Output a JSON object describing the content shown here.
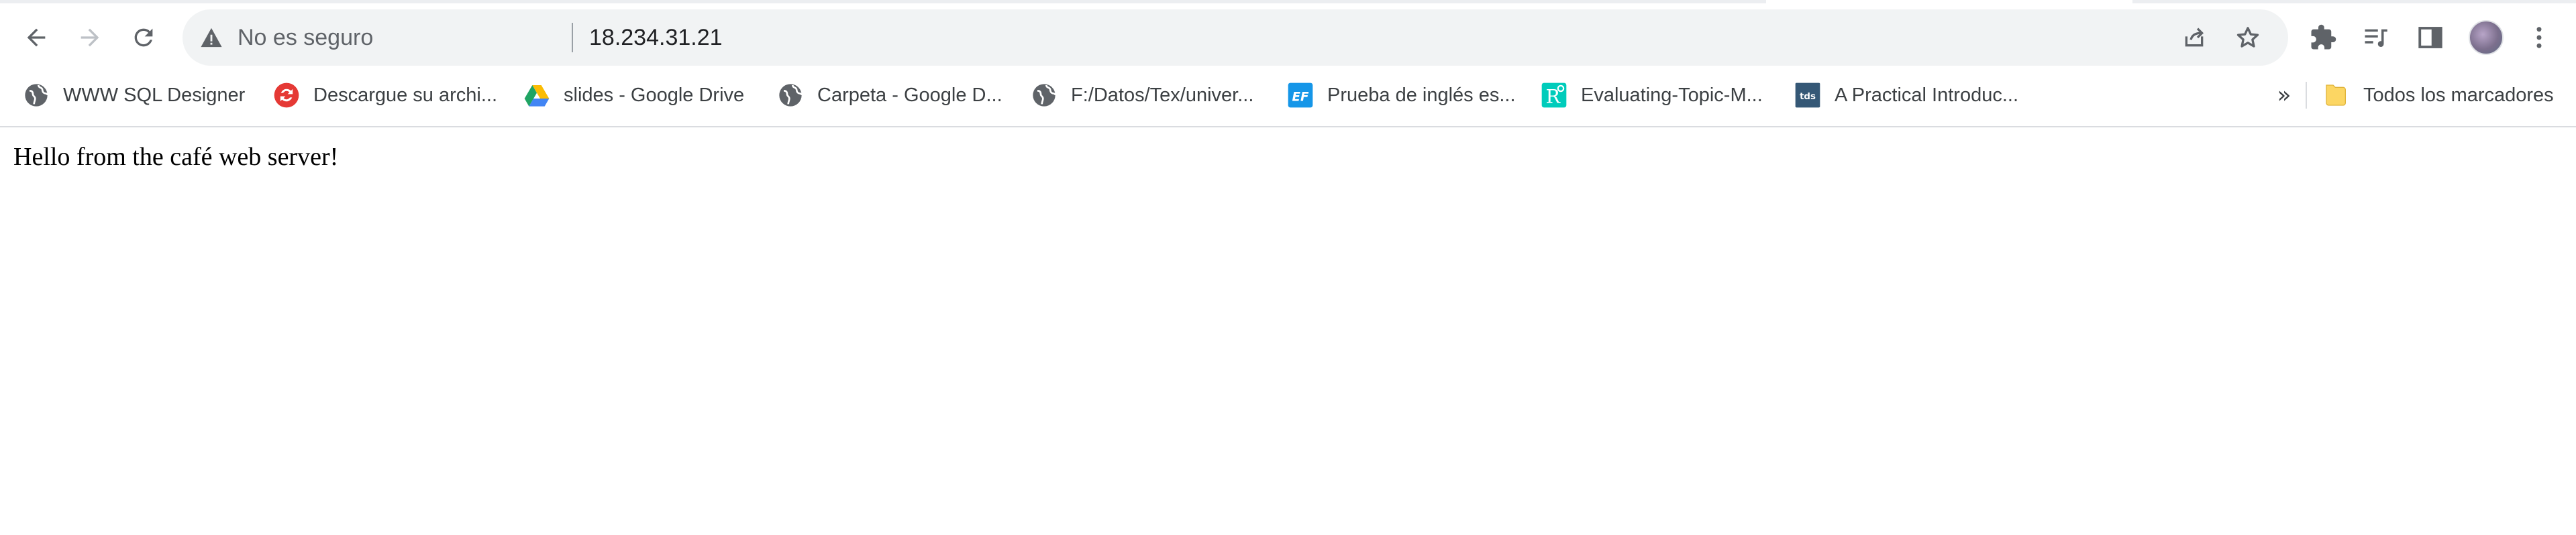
{
  "address_bar": {
    "security_text": "No es seguro",
    "url": "18.234.31.21"
  },
  "bookmarks": [
    {
      "label": "WWW SQL Designer",
      "icon": "globe-icon"
    },
    {
      "label": "Descargue su archi...",
      "icon": "red-recycle-icon"
    },
    {
      "label": "slides - Google Drive",
      "icon": "google-drive-icon"
    },
    {
      "label": "Carpeta - Google D...",
      "icon": "globe-icon"
    },
    {
      "label": "F:/Datos/Tex/univer...",
      "icon": "globe-icon"
    },
    {
      "label": "Prueba de inglés es...",
      "icon": "ef-icon",
      "icon_text": "EF"
    },
    {
      "label": "Evaluating-Topic-M...",
      "icon": "researchgate-icon",
      "icon_text": "R"
    },
    {
      "label": "A Practical Introduc...",
      "icon": "tds-icon",
      "icon_text": "tds"
    }
  ],
  "bookmarks_overflow": "»",
  "all_bookmarks": {
    "label": "Todos los marcadores",
    "icon": "folder-icon"
  },
  "page": {
    "text": "Hello from the café web server!"
  },
  "colors": {
    "omnibox_bg": "#f1f3f4",
    "icon_gray": "#5f6368",
    "ef_blue": "#1596e8",
    "researchgate_teal": "#00ccbb",
    "tds_navy": "#355876",
    "folder_yellow": "#fcd663"
  }
}
